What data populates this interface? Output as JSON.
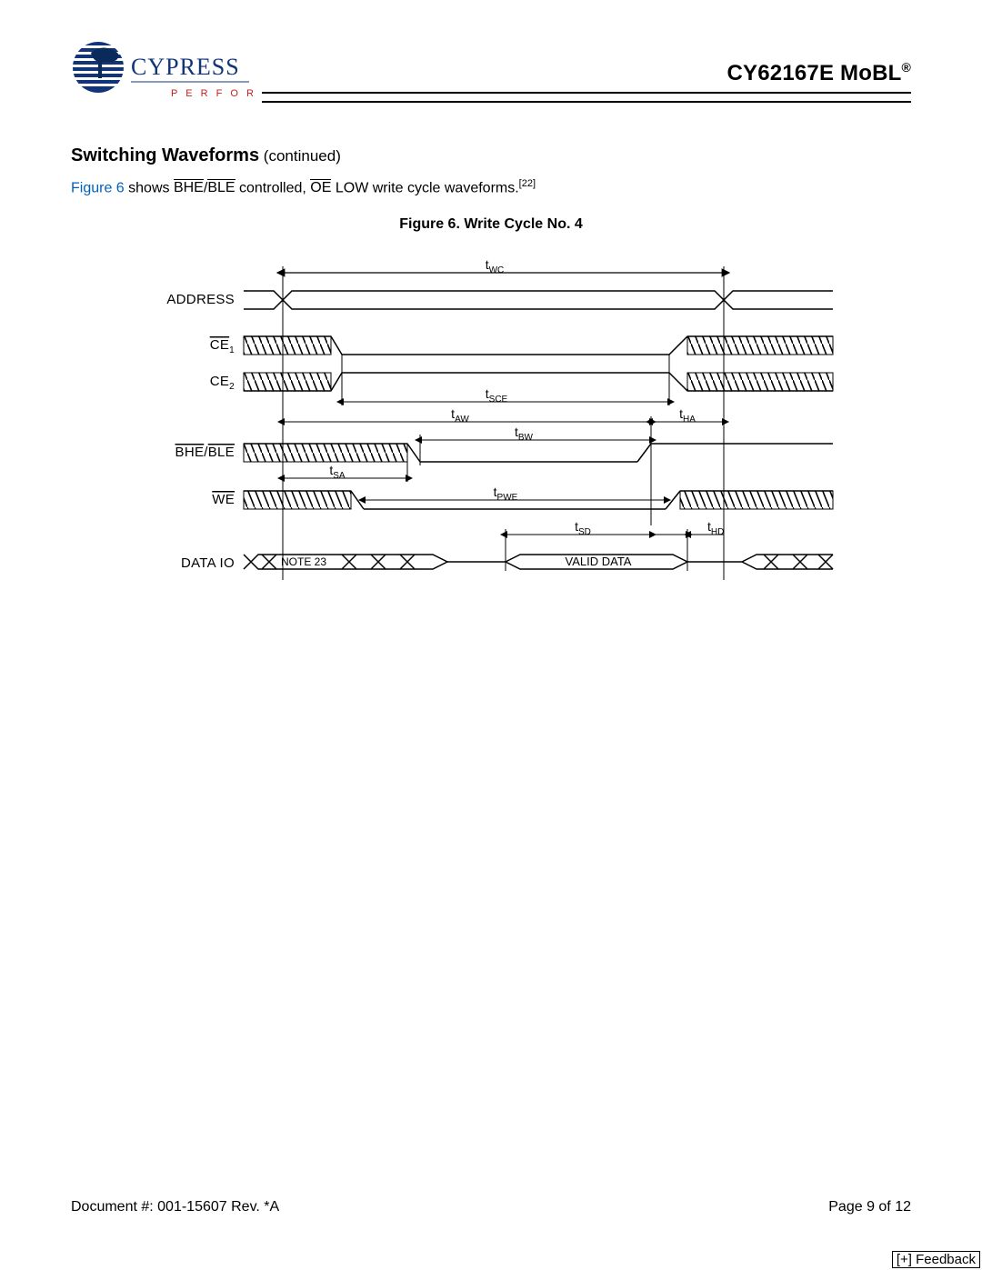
{
  "header": {
    "brand_name": "CYPRESS",
    "brand_tagline": "P E R F O R M",
    "doc_title": "CY62167E MoBL",
    "doc_title_sup": "®"
  },
  "section": {
    "heading_main": "Switching Waveforms",
    "heading_cont": " (continued)",
    "desc_prefix_link": "Figure 6",
    "desc_mid_1": " shows ",
    "desc_bhe": "BHE",
    "desc_slash": "/",
    "desc_ble": "BLE",
    "desc_mid_2": " controlled, ",
    "desc_oe": "OE",
    "desc_mid_3": " LOW write cycle waveforms.",
    "desc_sup": "[22]",
    "figure_caption": "Figure 6. Write Cycle No. 4"
  },
  "signals": {
    "address": "ADDRESS",
    "ce1": "CE",
    "ce1_sub": "1",
    "ce2": "CE",
    "ce2_sub": "2",
    "bhe_ble_bhe": "BHE",
    "bhe_ble_slash": "/",
    "bhe_ble_ble": "BLE",
    "we": "WE",
    "dataio": "DATA IO"
  },
  "timing": {
    "t_wc": "WC",
    "t_sce": "SCE",
    "t_aw": "AW",
    "t_ha": "HA",
    "t_bw": "BW",
    "t_sa": "SA",
    "t_pwe": "PWE",
    "t_sd": "SD",
    "t_hd": "HD",
    "note23": "NOTE 23",
    "valid_data": "VALID DATA"
  },
  "footer": {
    "docnum": "Document #: 001-15607 Rev. *A",
    "page": "Page 9 of 12",
    "feedback": "[+] Feedback"
  }
}
